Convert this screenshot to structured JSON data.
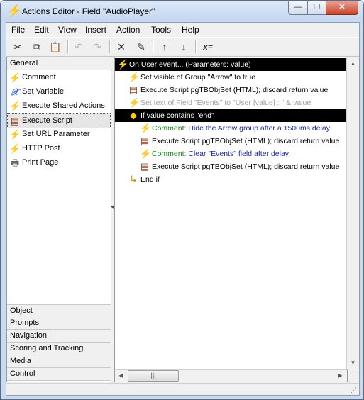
{
  "window": {
    "title": "Actions Editor - Field \"AudioPlayer\"",
    "minimize": "—",
    "maximize": "☐",
    "close": "✕"
  },
  "menu": [
    "File",
    "Edit",
    "View",
    "Insert",
    "Action",
    "Tools",
    "Help"
  ],
  "toolbar": {
    "cut": "✂",
    "copy": "⧉",
    "paste": "📋",
    "undo": "↶",
    "redo": "↷",
    "delete": "✕",
    "properties": "✎",
    "move_up": "↑",
    "move_down": "↓",
    "assign": "x="
  },
  "categories": {
    "general": "General",
    "bottom": [
      "Object",
      "Prompts",
      "Navigation",
      "Scoring and Tracking",
      "Media",
      "Control"
    ]
  },
  "actions": [
    {
      "label": "Comment",
      "icon": "⚡"
    },
    {
      "label": "Set Variable",
      "icon": "𝒳"
    },
    {
      "label": "Execute Shared Actions",
      "icon": "⚡"
    },
    {
      "label": "Execute Script",
      "icon": "▤"
    },
    {
      "label": "Set URL Parameter",
      "icon": "⚡"
    },
    {
      "label": "HTTP Post",
      "icon": "⚡"
    },
    {
      "label": "Print Page",
      "icon": "🖶"
    }
  ],
  "tree": [
    {
      "text": "On User event... (Parameters: value)",
      "icon": "⚡"
    },
    {
      "text": "Set visible of Group \"Arrow\" to true",
      "icon": "⚡"
    },
    {
      "text": "Execute Script pgTBObjSet (HTML); discard return value",
      "icon": "▤"
    },
    {
      "text": "Set text of Field \"Events\" to \"User [value] : \" & value",
      "icon": "⚡"
    },
    {
      "text": "If value contains \"end\"",
      "icon": "◆"
    },
    {
      "kw": "Comment:",
      "text": "Hide the Arrow group after a 1500ms delay",
      "icon": "⚡"
    },
    {
      "text": "Execute Script pgTBObjSet (HTML); discard return value",
      "icon": "▤"
    },
    {
      "kw": "Comment:",
      "text": "Clear \"Events\" field after delay.",
      "icon": "⚡"
    },
    {
      "text": "Execute Script pgTBObjSet (HTML); discard return value",
      "icon": "▤"
    },
    {
      "text": "End if",
      "icon": "↳"
    }
  ],
  "scrollbar": {
    "up": "▲",
    "down": "▼",
    "left": "◀",
    "right": "▶",
    "thumb_grip": "|||"
  },
  "colors": {
    "selected_row": "#000000",
    "comment_keyword": "#1a8a1a",
    "comment_text": "#1c2a9c",
    "bolt": "#e8c000"
  }
}
